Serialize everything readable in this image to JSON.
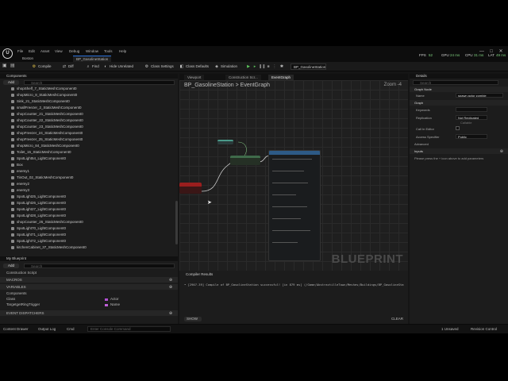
{
  "titlebar": {
    "menu": [
      "File",
      "Edit",
      "Asset",
      "View",
      "Debug",
      "Window",
      "Tools",
      "Help"
    ],
    "tabs": [
      "Boston",
      "BP_GasolineStation"
    ],
    "fps_label": "FPS",
    "fps": "52",
    "gpu_label": "GPU",
    "gpu": "24 ms",
    "cpu_label": "CPU",
    "cpu": "31 ms",
    "lat_label": "LAT",
    "lat": "49 ms",
    "minimize": "—",
    "maximize": "□",
    "close": "✕"
  },
  "toolbar": {
    "compile": "Compile",
    "diff": "Diff",
    "find": "Find",
    "hide_unrelated": "Hide Unrelated",
    "class_settings": "Class Settings",
    "class_defaults": "Class Defaults",
    "simulation": "Simulation",
    "debug_object": "BP_GasolineStation"
  },
  "components": {
    "title": "Components",
    "add": "Add",
    "search_placeholder": "Search",
    "items": [
      "shopShelf_7_StaticMeshComponent0",
      "shopMicro_8_StaticMeshComponent0",
      "Sink_21_StaticMeshComponent0",
      "smallFreezer_2_StaticMeshComponent0",
      "shopCounter_21_StaticMeshComponent0",
      "shopCounter_22_StaticMeshComponent0",
      "shopCounter_23_StaticMeshComponent0",
      "shopFreezer_24_StaticMeshComponent0",
      "shopFreezer_25_StaticMeshComponent0",
      "shopMicro_84_StaticMeshComponent0",
      "Toilet_15_StaticMeshComponent0",
      "SpotLight54_LightComponent0",
      "Box",
      "enemy1",
      "TinOut_02_StaticMeshComponent0",
      "enemy2",
      "enemy3",
      "SpotLight25_LightComponent0",
      "SpotLight26_LightComponent0",
      "SpotLight27_LightComponent0",
      "SpotLight28_LightComponent0",
      "shopCounter_26_StaticMeshComponent0",
      "SpotLight70_LightComponent0",
      "SpotLight71_LightComponent0",
      "SpotLight72_LightComponent0",
      "kitchenCabinet_37_StaticMeshComponent0"
    ]
  },
  "myblueprint": {
    "title": "My Blueprint",
    "add": "Add",
    "search_placeholder": "Search",
    "construction_script": "Construction Script",
    "macros": "MACROS",
    "variables": "VARIABLES",
    "components_header": "Components",
    "var1_name": "Class",
    "var1_type": "Actor",
    "var2_name": "TargetgetRingTrigger",
    "var2_type": "Name",
    "event_dispatchers": "EVENT DISPATCHERS"
  },
  "editor": {
    "tabs": [
      "Viewport",
      "Construction Scr...",
      "EventGraph"
    ],
    "breadcrumb_root": "BP_GasolineStation",
    "breadcrumb_sep": ">",
    "breadcrumb_leaf": "EventGraph",
    "zoom": "Zoom -4",
    "watermark": "BLUEPRINT"
  },
  "compiler": {
    "title": "Compiler Results",
    "log": "• [2907.39] Compile of BP_GasolineStation successful! [in 879 ms] (/Game/AbstractilleTown/Meshes/Buildings/BP_GasolineSta",
    "show": "SHOW",
    "clear": "CLEAR"
  },
  "details": {
    "title": "Details",
    "search_placeholder": "Search",
    "graph_node_section": "Graph Node",
    "name_label": "Name",
    "name_value": "spawn actor zombie",
    "graph_section": "Graph",
    "keywords_label": "Keywords",
    "replication_label": "Replication",
    "replication_value": "Not Replicated",
    "replication_sub": "Callable",
    "call_in_editor_label": "Call In Editor",
    "access_label": "Access Specifier",
    "access_value": "Public",
    "advanced": "Advanced",
    "inputs_section": "Inputs",
    "inputs_hint": "Please press the + icon above to add parameters"
  },
  "statusbar": {
    "content_drawer": "Content Drawer",
    "output_log": "Output Log",
    "cmd": "Cmd",
    "cmd_placeholder": "Enter Console Command",
    "unsaved": "1 Unsaved",
    "revision_control": "Revision Control"
  },
  "colors": {
    "accent": "#2a6fd8",
    "node_event": "#8a1a1a",
    "node_function": "#2d5a86",
    "node_pure": "#3f6a4a",
    "wire": "#d0d0d0"
  }
}
